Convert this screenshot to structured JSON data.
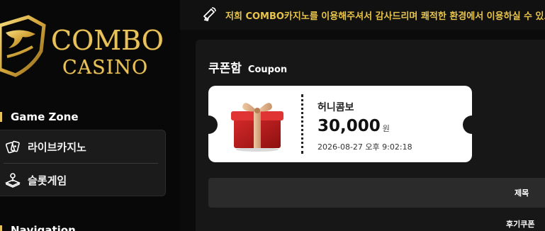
{
  "brand": {
    "logo_line1": "COMBO",
    "logo_line2": "CASINO",
    "accent": "#e6c35a"
  },
  "notice": {
    "icon": "megaphone-icon",
    "text": "저희 COMBO카지노를 이용해주셔서 감사드리며 쾌적한 환경에서 이용하실 수 있도록"
  },
  "sidebar": {
    "section_game_zone": "Game Zone",
    "items": [
      {
        "label": "라이브카지노",
        "icon": "cards-icon"
      },
      {
        "label": "슬롯게임",
        "icon": "joystick-icon"
      }
    ],
    "section_navigation": "Navigation"
  },
  "page": {
    "title": "쿠폰함",
    "subtitle": "Coupon"
  },
  "coupon": {
    "name": "허니콤보",
    "amount": "30,000",
    "unit": "원",
    "date": "2026-08-27 오후 9:02:18",
    "icon": "gift-box-icon"
  },
  "table": {
    "header_title": "제목",
    "rows": [
      {
        "title": "후기쿠폰"
      }
    ]
  }
}
